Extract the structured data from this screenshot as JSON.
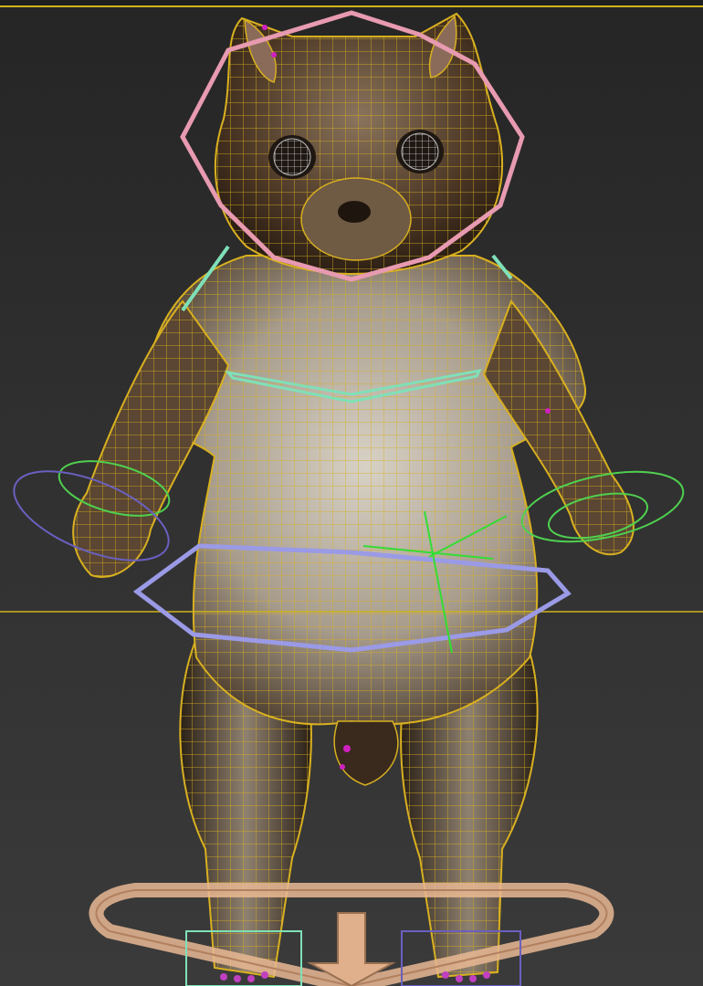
{
  "viewport": {
    "background_colors": [
      "#252525",
      "#3a3a3a"
    ],
    "active_border_color": "#d1b31a"
  },
  "model": {
    "wireframe_color": "#d8b020",
    "fur_dark": "#3b2a1c",
    "fur_mid": "#6e5640",
    "belly": "#c9c2b5"
  },
  "rig_controls": {
    "head_control_color": "#e79ab0",
    "chest_control_color": "#7fe0b8",
    "hip_control_color": "#9a9ae6",
    "hand_control_color": "#4fd04f",
    "hand_control_alt_color": "#6a60c0",
    "root_control_color": "#e9b994",
    "pivot_color": "#33dd33",
    "selection_color": "#d020c0"
  },
  "icons": {
    "root_arrow": "down-arrow-icon",
    "pivot": "crosshair-icon"
  }
}
